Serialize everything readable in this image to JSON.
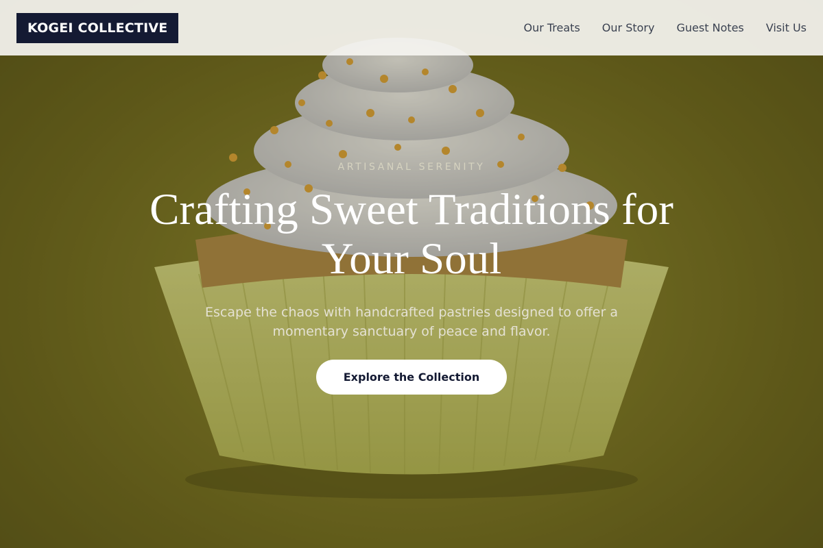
{
  "header": {
    "logo": "KOGEI COLLECTIVE",
    "nav": [
      "Our Treats",
      "Our Story",
      "Guest Notes",
      "Visit Us"
    ]
  },
  "hero": {
    "eyebrow": "ARTISANAL SERENITY",
    "headline": "Crafting Sweet Traditions for Your Soul",
    "subtitle": "Escape the chaos with handcrafted pastries designed to offer a momentary sanctuary of peace and flavor.",
    "cta_label": "Explore the Collection",
    "background_image": "cupcake-photo"
  },
  "colors": {
    "brand_dark": "#141a33",
    "background_olive": "#6b661f",
    "header_bg": "#f5f4f0",
    "cta_bg": "#ffffff"
  }
}
